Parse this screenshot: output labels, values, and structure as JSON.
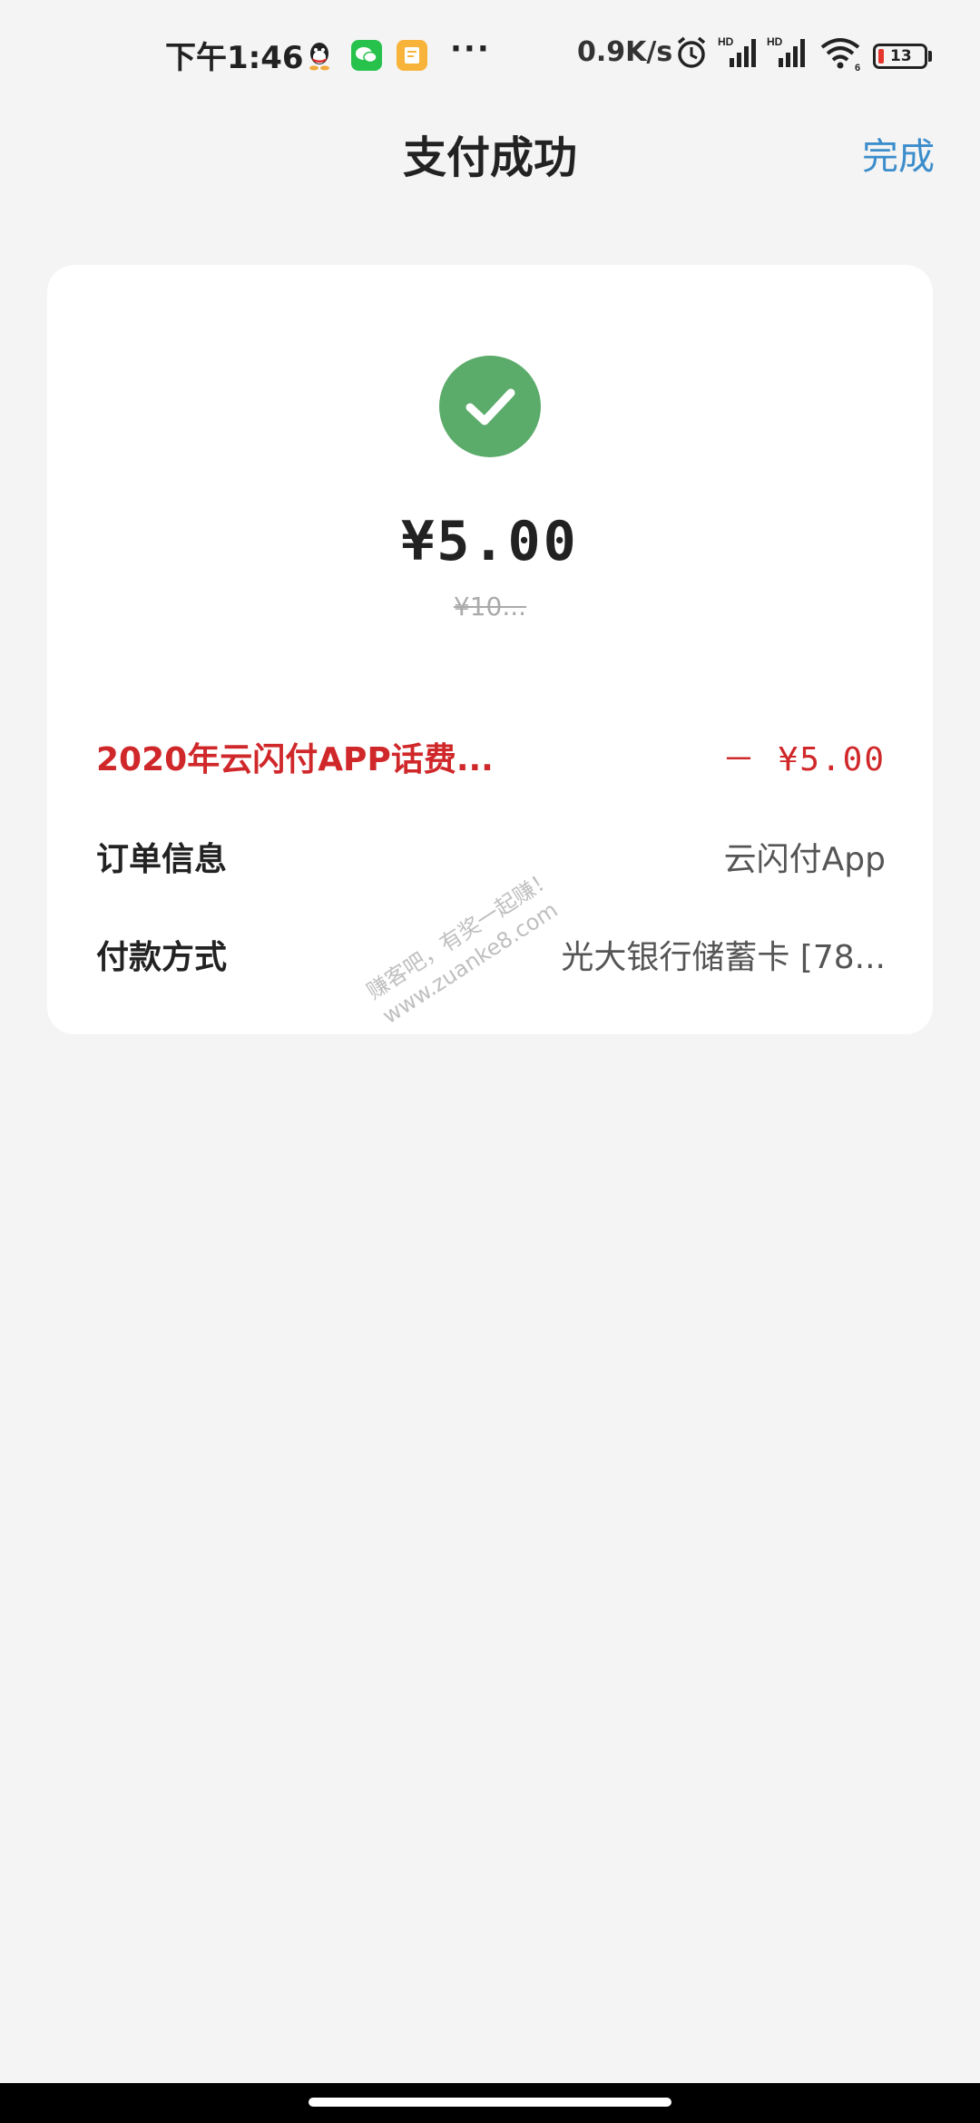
{
  "status_bar": {
    "time": "下午1:46",
    "more": "···",
    "net_speed": "0.9K/s",
    "battery": "13",
    "icons": [
      "qq-icon",
      "wechat-icon",
      "notes-icon",
      "alarm-icon",
      "signal-hd-icon",
      "signal-hd-icon",
      "wifi-icon",
      "battery-icon"
    ],
    "colors": {
      "battery_low": "#e5352d",
      "wechat": "#27c24c",
      "notes": "#f8b43a"
    }
  },
  "header": {
    "title": "支付成功",
    "done_label": "完成",
    "done_color": "#3c8dcb"
  },
  "payment": {
    "success_icon": "check-circle-icon",
    "success_color": "#5bab6a",
    "amount": "¥5.00",
    "original_amount": "¥10..."
  },
  "details": {
    "discount_label": "2020年云闪付APP话费...",
    "discount_value": "－ ¥5.00",
    "discount_color": "#d0282a",
    "order_label": "订单信息",
    "order_value": "云闪付App",
    "method_label": "付款方式",
    "method_value": "光大银行储蓄卡 [78..."
  },
  "watermark": {
    "line1": "赚客吧，有奖一起赚！",
    "line2": "www.zuanke8.com"
  }
}
